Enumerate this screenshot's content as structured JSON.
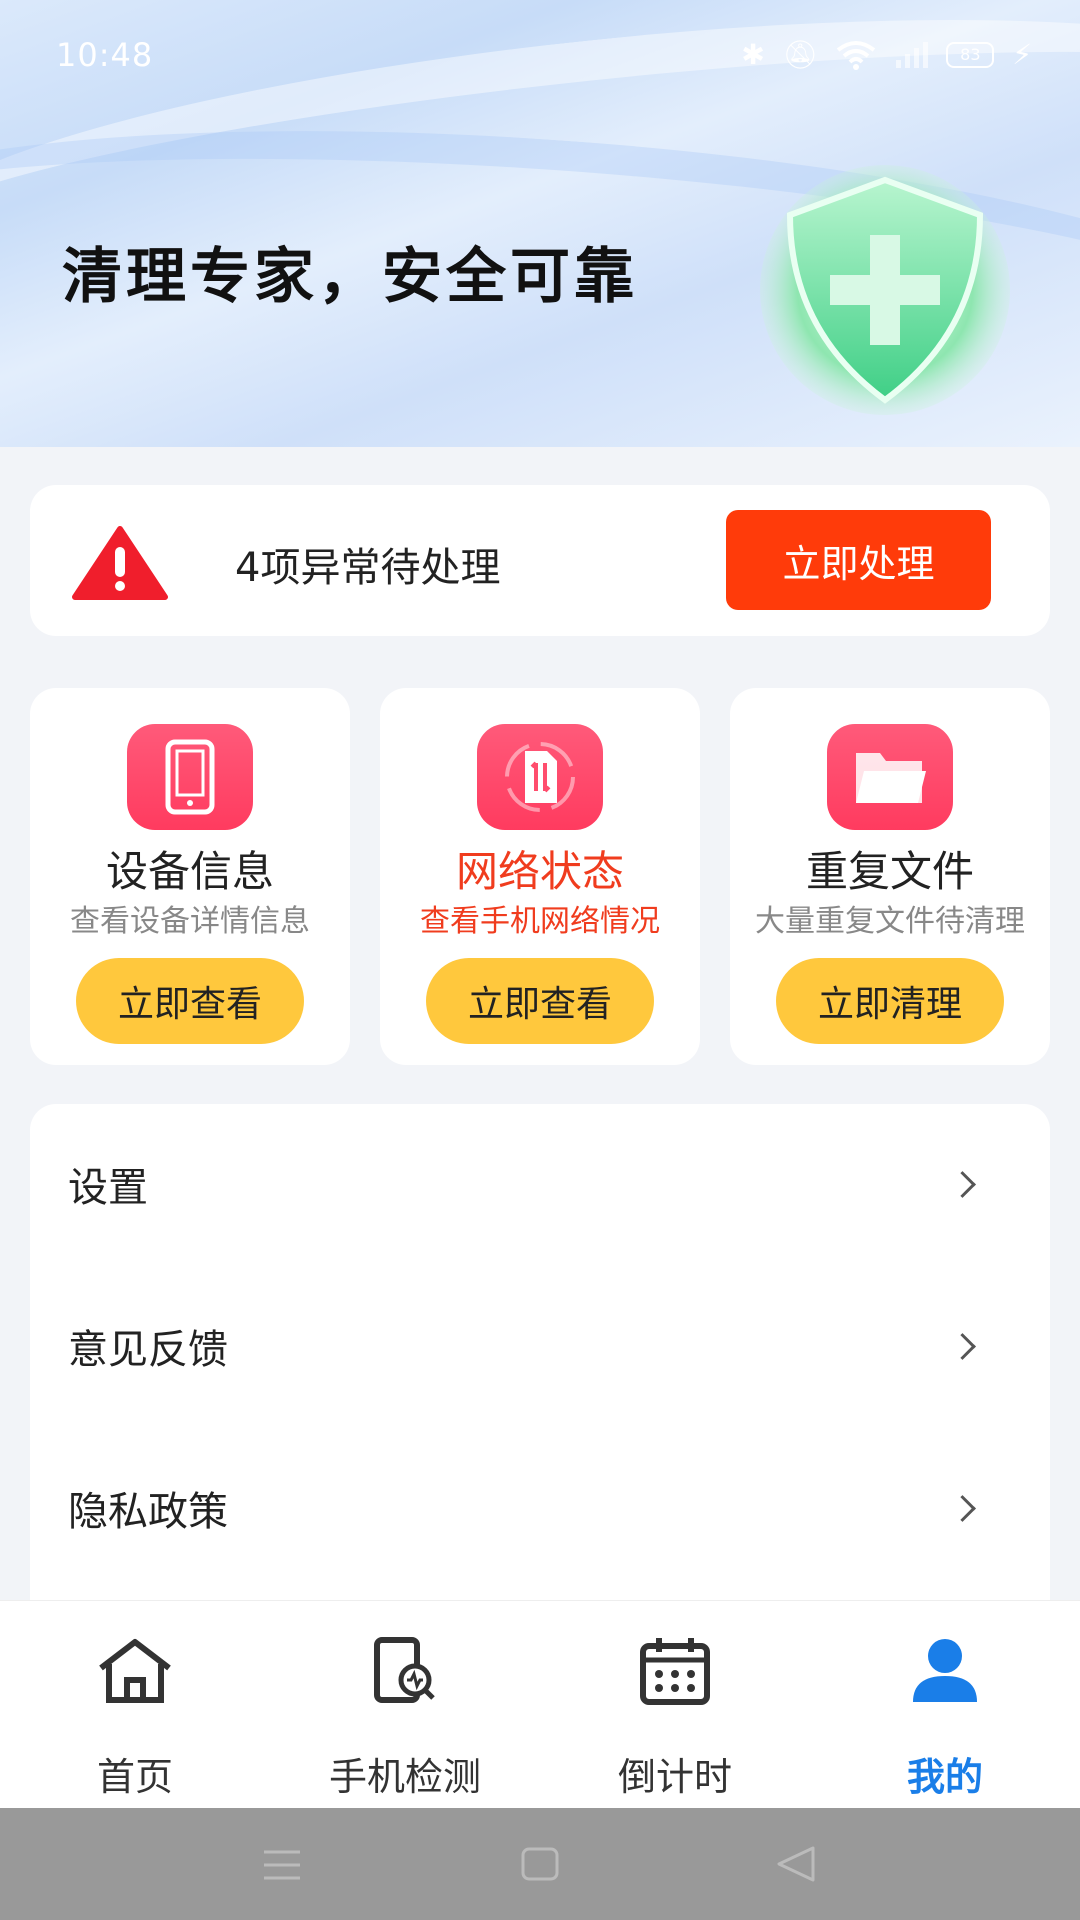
{
  "status_bar": {
    "time": "10:48",
    "battery": "83"
  },
  "banner": {
    "slogan": "清理专家，安全可靠"
  },
  "alert": {
    "text": "4项异常待处理",
    "button": "立即处理"
  },
  "tiles": [
    {
      "title": "设备信息",
      "subtitle": "查看设备详情信息",
      "button": "立即查看",
      "icon": "phone-icon"
    },
    {
      "title": "网络状态",
      "subtitle": "查看手机网络情况",
      "button": "立即查看",
      "icon": "sim-transfer-icon"
    },
    {
      "title": "重复文件",
      "subtitle": "大量重复文件待清理",
      "button": "立即清理",
      "icon": "folder-icon"
    }
  ],
  "menu": [
    {
      "label": "设置"
    },
    {
      "label": "意见反馈"
    },
    {
      "label": "隐私政策"
    }
  ],
  "tabs": [
    {
      "label": "首页",
      "icon": "home-icon"
    },
    {
      "label": "手机检测",
      "icon": "phone-scan-icon"
    },
    {
      "label": "倒计时",
      "icon": "calendar-icon"
    },
    {
      "label": "我的",
      "icon": "user-icon"
    }
  ],
  "colors": {
    "accent": "#1a7ee8",
    "alert_button": "#ff3b0a",
    "tile_button": "#ffc83d",
    "icon_bg": "#ff4d6d",
    "highlight_text": "#f03c1e"
  }
}
